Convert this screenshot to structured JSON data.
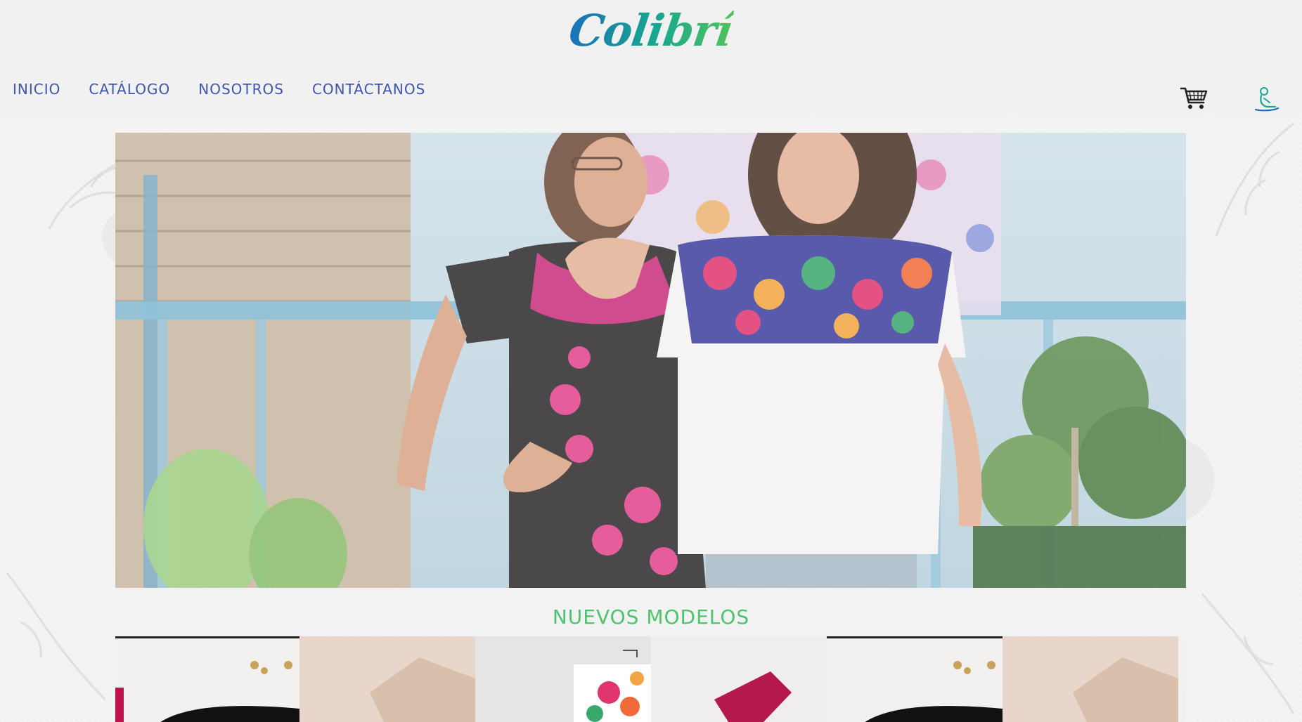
{
  "brand": {
    "name": "Colibrí",
    "colors": {
      "primary_blue": "#3f55b0",
      "teal": "#18a88f",
      "green": "#4cc46e"
    }
  },
  "nav": {
    "items": [
      {
        "label": "INICIO"
      },
      {
        "label": "CATÁLOGO"
      },
      {
        "label": "NOSOTROS"
      },
      {
        "label": "CONTÁCTANOS"
      }
    ]
  },
  "header_icons": {
    "cart": "cart-icon",
    "user": "user-icon"
  },
  "sections": {
    "new_models_title": "NUEVOS MODELOS"
  },
  "products": [
    {
      "name": "product-1"
    },
    {
      "name": "product-2"
    },
    {
      "name": "product-3"
    },
    {
      "name": "product-4"
    },
    {
      "name": "product-5"
    },
    {
      "name": "product-6"
    }
  ]
}
